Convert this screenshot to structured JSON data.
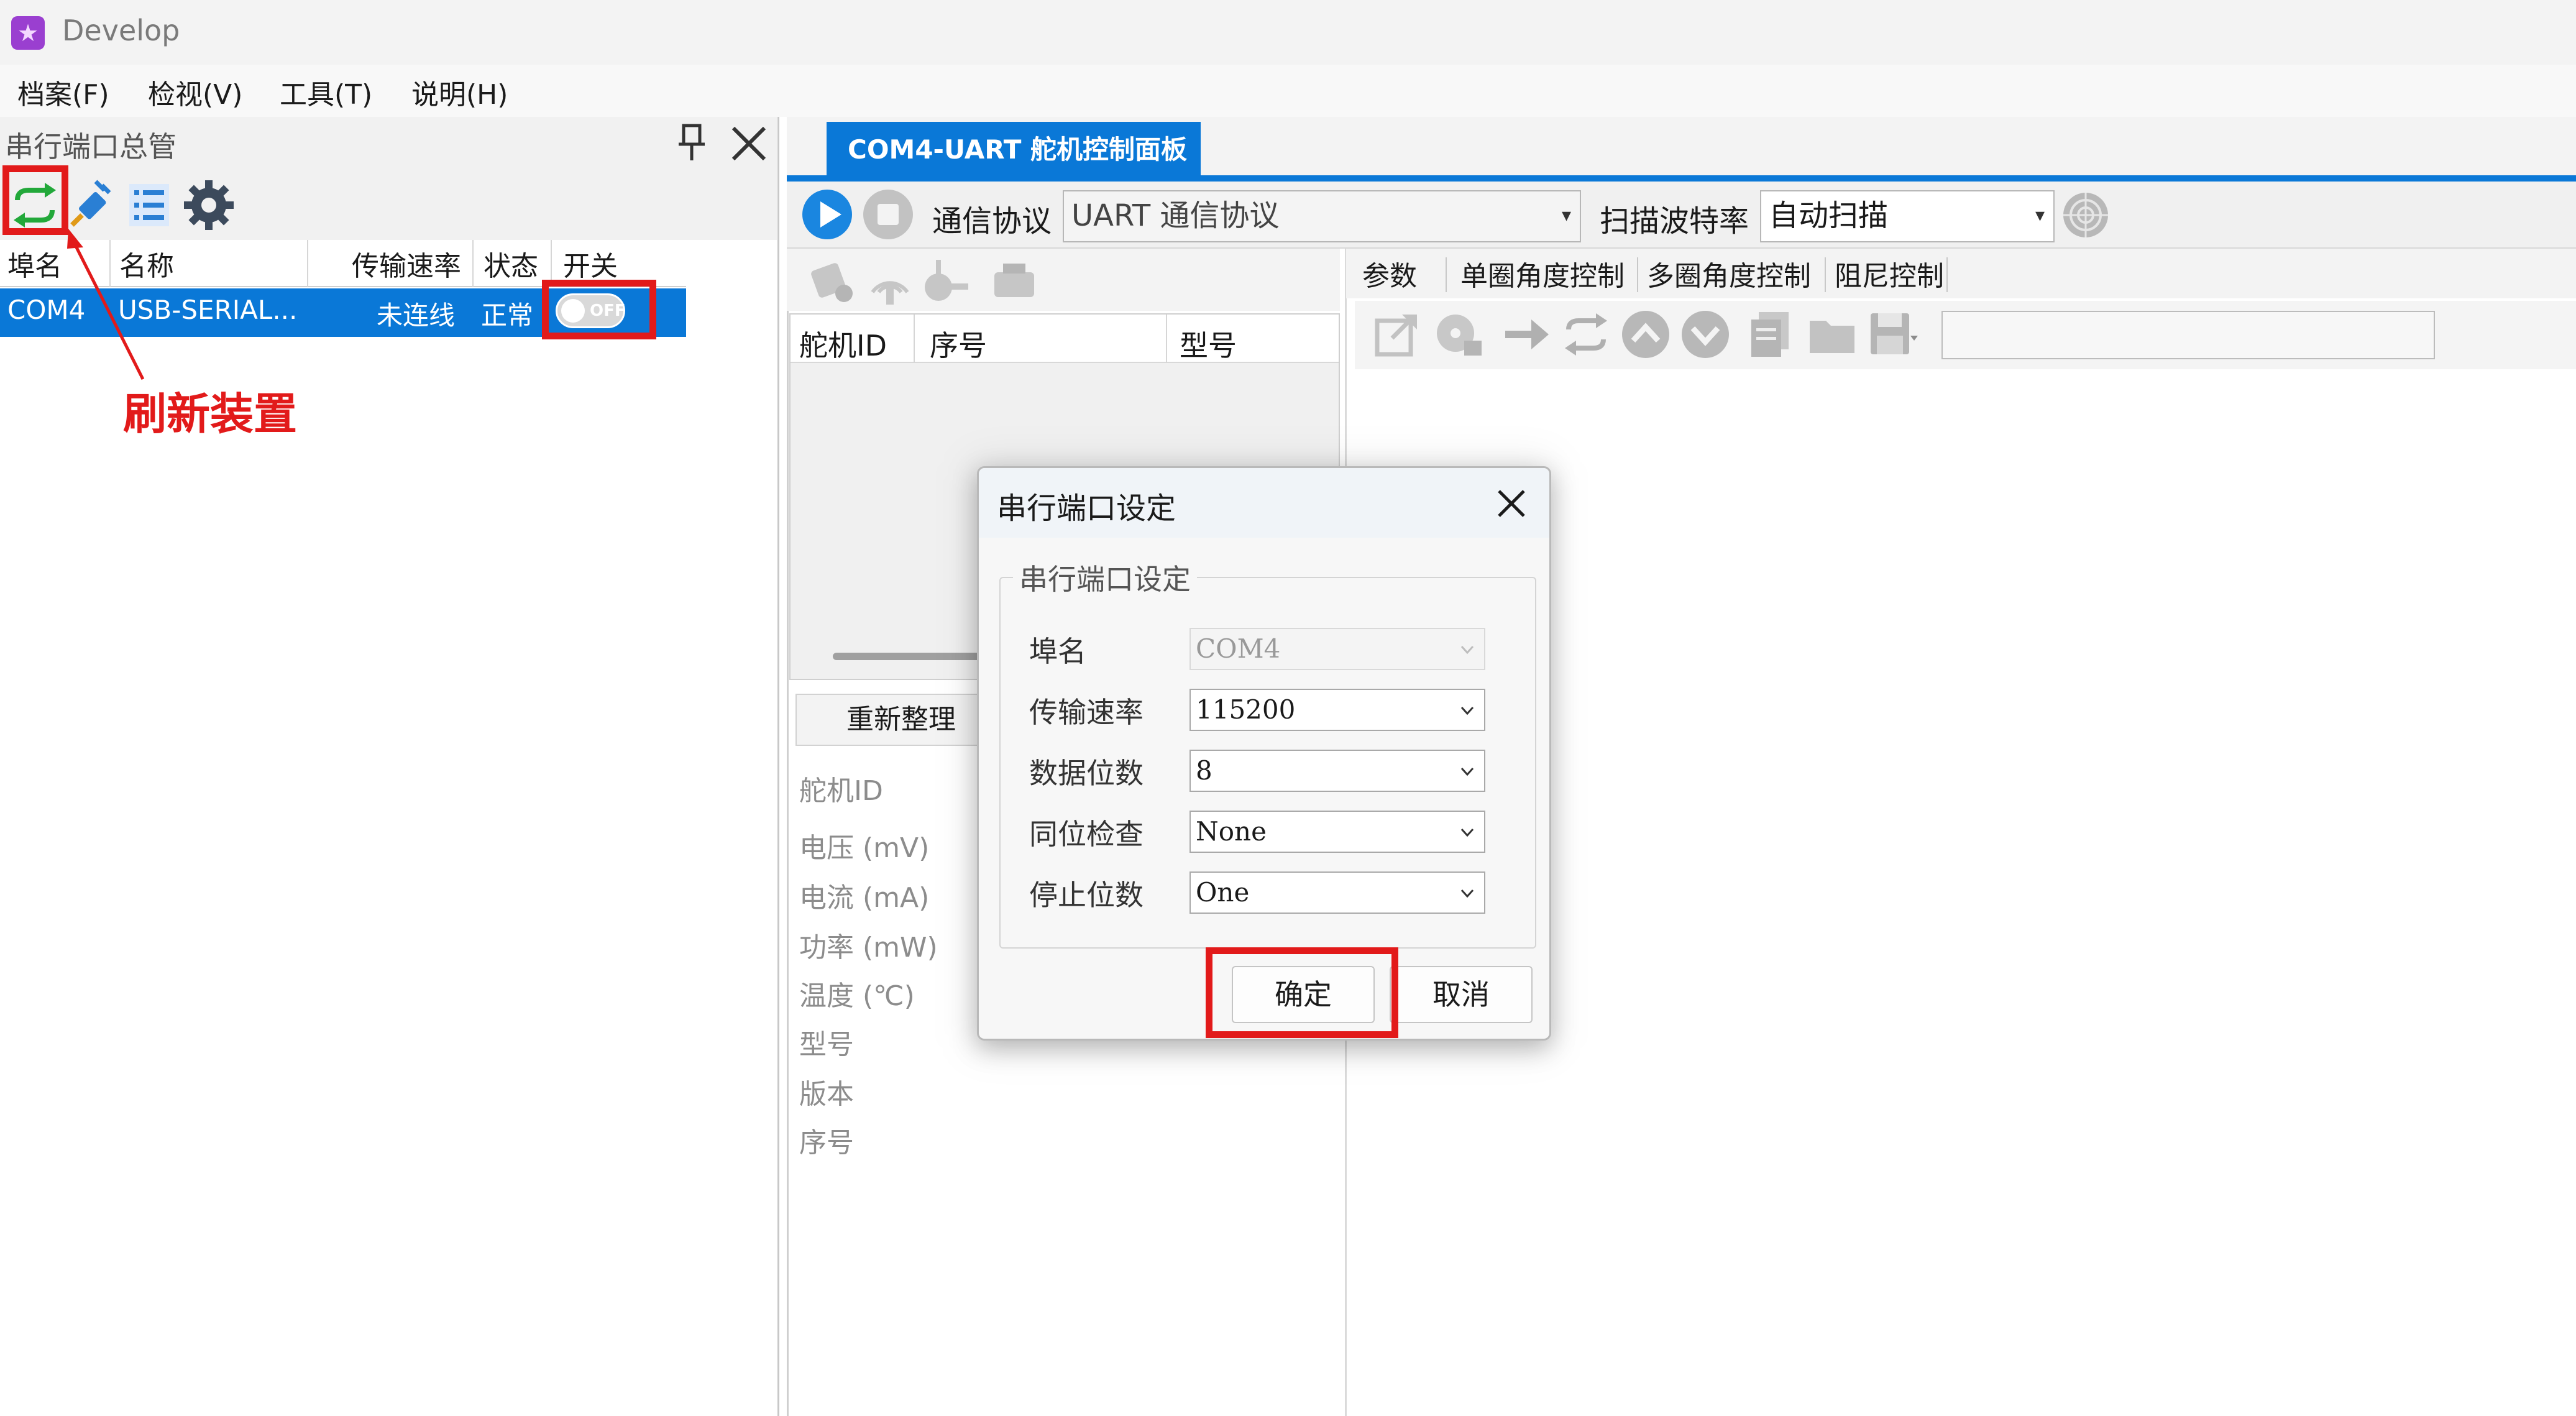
{
  "window": {
    "title": "Develop"
  },
  "menu": [
    "档案(F)",
    "检视(V)",
    "工具(T)",
    "说明(H)"
  ],
  "left_panel": {
    "title": "串行端口总管",
    "columns": [
      "埠名",
      "名称",
      "传输速率",
      "状态",
      "开关"
    ],
    "rows": [
      {
        "port": "COM4",
        "name": "USB-SERIAL...",
        "baud": "未连线",
        "state": "正常",
        "switch": "OFF"
      }
    ],
    "annotation": "刷新装置"
  },
  "main": {
    "active_tab": "COM4-UART 舵机控制面板",
    "protocol_label": "通信协议",
    "protocol_value": "UART 通信协议",
    "scan_baud_label": "扫描波特率",
    "scan_baud_value": "自动扫描",
    "servo_columns": [
      "舵机ID",
      "序号",
      "型号"
    ],
    "reorganize_button": "重新整理",
    "info_labels": [
      "舵机ID",
      "电压 (mV)",
      "电流 (mA)",
      "功率 (mW)",
      "温度 (℃)",
      "型号",
      "版本",
      "序号"
    ],
    "param_tabs": [
      "参数",
      "单圈角度控制",
      "多圈角度控制",
      "阻尼控制"
    ]
  },
  "dialog": {
    "title": "串行端口设定",
    "group_title": "串行端口设定",
    "fields": [
      {
        "label": "埠名",
        "value": "COM4"
      },
      {
        "label": "传输速率",
        "value": "115200"
      },
      {
        "label": "数据位数",
        "value": "8"
      },
      {
        "label": "同位检查",
        "value": "None"
      },
      {
        "label": "停止位数",
        "value": "One"
      }
    ],
    "ok_button": "确定",
    "cancel_button": "取消"
  },
  "colors": {
    "accent": "#0a78d7",
    "annotation_red": "#e21a1a"
  }
}
